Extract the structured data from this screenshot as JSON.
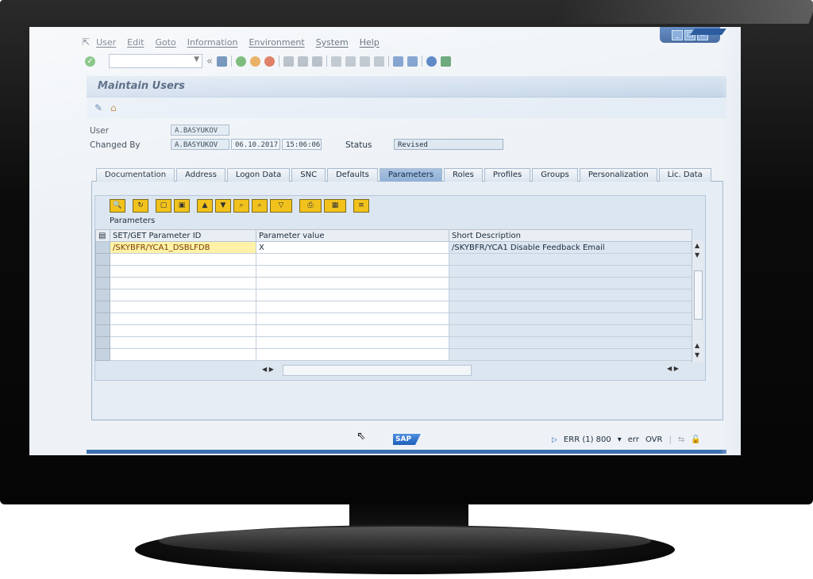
{
  "menu": {
    "items": [
      "User",
      "Edit",
      "Goto",
      "Information",
      "Environment",
      "System",
      "Help"
    ]
  },
  "toolbar": {
    "command_field_value": "",
    "back_symbol": "«"
  },
  "screen": {
    "title": "Maintain Users"
  },
  "header": {
    "user_label": "User",
    "user_value": "A.BASYUKOV",
    "changed_by_label": "Changed By",
    "changed_by_value": "A.BASYUKOV",
    "changed_date": "06.10.2017",
    "changed_time": "15:06:06",
    "status_label": "Status",
    "status_value": "Revised"
  },
  "tabs": [
    {
      "label": "Documentation",
      "active": false
    },
    {
      "label": "Address",
      "active": false
    },
    {
      "label": "Logon Data",
      "active": false
    },
    {
      "label": "SNC",
      "active": false
    },
    {
      "label": "Defaults",
      "active": false
    },
    {
      "label": "Parameters",
      "active": true
    },
    {
      "label": "Roles",
      "active": false
    },
    {
      "label": "Profiles",
      "active": false
    },
    {
      "label": "Groups",
      "active": false
    },
    {
      "label": "Personalization",
      "active": false
    },
    {
      "label": "Lic. Data",
      "active": false
    }
  ],
  "grid": {
    "caption": "Parameters",
    "columns": [
      "SET/GET Parameter ID",
      "Parameter value",
      "Short Description"
    ],
    "rows": [
      [
        "/SKYBFR/YCA1_DSBLFDB",
        "X",
        "/SKYBFR/YCA1 Disable Feedback Email"
      ]
    ],
    "empty_rows": 9
  },
  "status": {
    "sap_logo": "SAP",
    "system": "ERR (1) 800",
    "client_host": "err",
    "mode": "OVR"
  },
  "colors": {
    "title_band": "#c4d5e8",
    "active_tab": "#8fb0d6",
    "highlight_cell": "#fff2a8",
    "sap_blue": "#1e5fb8"
  }
}
